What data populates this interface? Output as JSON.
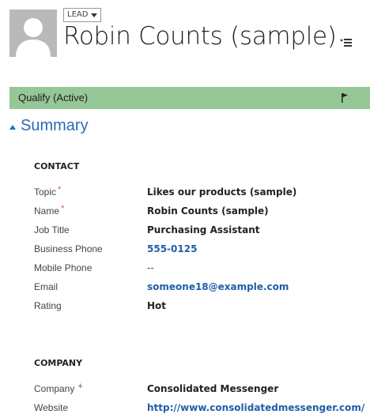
{
  "header": {
    "entity_label": "LEAD",
    "title": "Robin Counts (sample)"
  },
  "process": {
    "stage_label": "Qualify (Active)"
  },
  "section": {
    "title": "Summary"
  },
  "contact": {
    "group_title": "CONTACT",
    "fields": [
      {
        "label": "Topic",
        "marker": "*",
        "value": "Likes our products (sample)"
      },
      {
        "label": "Name",
        "marker": "*",
        "value": "Robin Counts (sample)"
      },
      {
        "label": "Job Title",
        "marker": "",
        "value": "Purchasing Assistant"
      },
      {
        "label": "Business Phone",
        "marker": "",
        "value": "555-0125"
      },
      {
        "label": "Mobile Phone",
        "marker": "",
        "value": "--"
      },
      {
        "label": "Email",
        "marker": "",
        "value": "someone18@example.com"
      },
      {
        "label": "Rating",
        "marker": "",
        "value": "Hot"
      }
    ]
  },
  "company": {
    "group_title": "COMPANY",
    "fields": [
      {
        "label": "Company",
        "marker": "+",
        "value": "Consolidated Messenger"
      },
      {
        "label": "Website",
        "marker": "",
        "value": "http://www.consolidatedmessenger.com/"
      }
    ]
  },
  "colors": {
    "process_bar": "#96c797",
    "accent": "#2a69b5",
    "link": "#1f5fa8",
    "required_marker": "#d9534f"
  }
}
